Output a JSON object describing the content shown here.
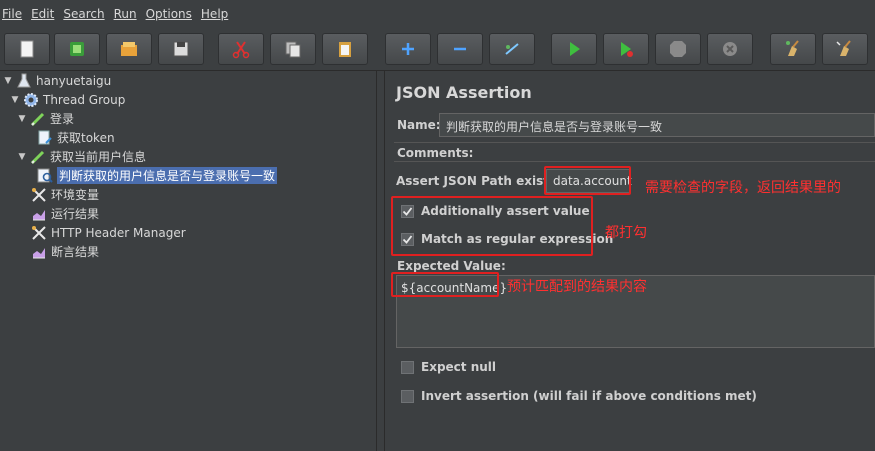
{
  "menu": [
    "File",
    "Edit",
    "Search",
    "Run",
    "Options",
    "Help"
  ],
  "toolbar": {
    "buttons": [
      "new-icon",
      "templates-icon",
      "open-icon",
      "save-icon",
      "cut-icon",
      "copy-icon",
      "paste-icon",
      "expand-icon",
      "collapse-icon",
      "toggle-icon",
      "start-icon",
      "start-no-pause-icon",
      "stop-icon",
      "shutdown-icon",
      "clear-icon",
      "clear-all-icon"
    ]
  },
  "tree": {
    "root": "hanyuetaigu",
    "thread_group": "Thread Group",
    "login": "登录",
    "get_token": "获取token",
    "get_user_info": "获取当前用户信息",
    "assertion": "判断获取的用户信息是否与登录账号一致",
    "env_vars": "环境变量",
    "run_results": "运行结果",
    "header_manager": "HTTP Header Manager",
    "assert_results": "断言结果"
  },
  "panel": {
    "title": "JSON Assertion",
    "name_label": "Name:",
    "name_value": "判断获取的用户信息是否与登录账号一致",
    "comments_label": "Comments:",
    "path_label": "Assert JSON Path exists:",
    "path_value": "data.account",
    "additionally_assert": "Additionally assert value",
    "match_regex": "Match as regular expression",
    "expected_label": "Expected Value:",
    "expected_value": "${accountName}",
    "expect_null": "Expect null",
    "invert": "Invert assertion (will fail if above conditions met)"
  },
  "annotations": {
    "path_note": "需要检查的字段，返回结果里的",
    "check_note": "都打勾",
    "expected_note": "预计匹配到的结果内容"
  },
  "colors": {
    "background": "#3c3f41",
    "selection": "#4b6eaf",
    "annotation": "#e02020"
  }
}
